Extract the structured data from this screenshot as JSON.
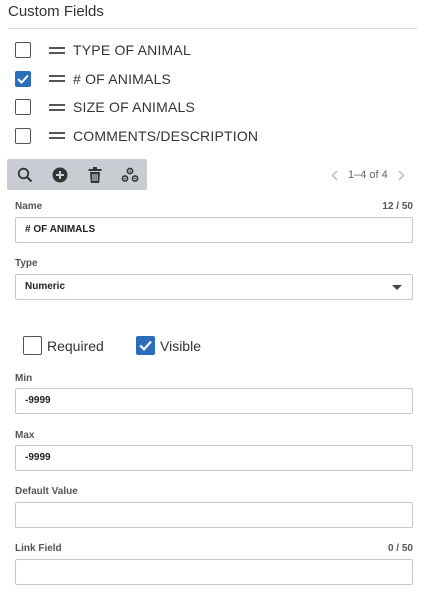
{
  "header": {
    "title": "Custom Fields"
  },
  "fields": [
    {
      "label": "TYPE OF ANIMAL",
      "checked": false
    },
    {
      "label": "# OF ANIMALS",
      "checked": true
    },
    {
      "label": "SIZE OF ANIMALS",
      "checked": false
    },
    {
      "label": "COMMENTS/DESCRIPTION",
      "checked": false
    }
  ],
  "toolbar": {
    "icons": [
      "search-icon",
      "add-circle-icon",
      "trash-icon",
      "settings-icon"
    ]
  },
  "pager": {
    "text": "1–4 of 4"
  },
  "form": {
    "name_label": "Name",
    "name_count": "12 / 50",
    "name_value": "# OF ANIMALS",
    "type_label": "Type",
    "type_value": "Numeric",
    "required_label": "Required",
    "required_checked": false,
    "visible_label": "Visible",
    "visible_checked": true,
    "min_label": "Min",
    "min_value": "-9999",
    "max_label": "Max",
    "max_value": "-9999",
    "default_label": "Default Value",
    "default_value": "",
    "link_label": "Link Field",
    "link_count": "0 / 50",
    "link_value": ""
  },
  "colors": {
    "accent": "#2a6ebb",
    "toolbar_bg": "#c9ccd2",
    "border": "#c8c8c8"
  }
}
